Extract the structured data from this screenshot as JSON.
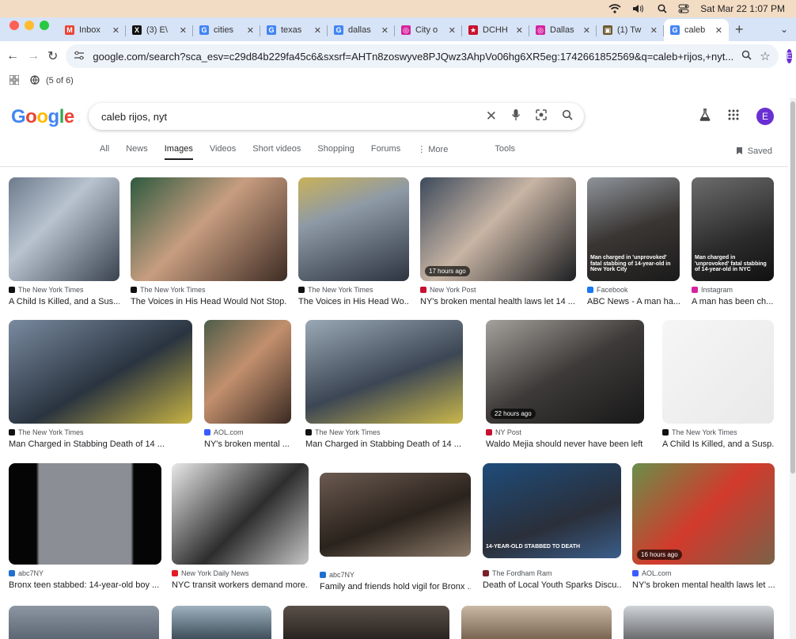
{
  "menubar": {
    "datetime": "Sat Mar 22  1:07 PM"
  },
  "tabs": [
    {
      "label": "Inbox",
      "fav": "M",
      "color": "#ea4335"
    },
    {
      "label": "(3) E\\",
      "fav": "X",
      "color": "#111111"
    },
    {
      "label": "cities",
      "fav": "G",
      "color": "#4285f4"
    },
    {
      "label": "texas",
      "fav": "G",
      "color": "#4285f4"
    },
    {
      "label": "dallas",
      "fav": "G",
      "color": "#4285f4"
    },
    {
      "label": "City o",
      "fav": "◎",
      "color": "#d6249f"
    },
    {
      "label": "DCHH",
      "fav": "★",
      "color": "#c8102e"
    },
    {
      "label": "Dallas",
      "fav": "◎",
      "color": "#d6249f"
    },
    {
      "label": "(1) Tw",
      "fav": "▣",
      "color": "#6b5a2e"
    },
    {
      "label": "caleb",
      "fav": "G",
      "color": "#4285f4"
    }
  ],
  "omnibox": {
    "url": "google.com/search?sca_esv=c29d84b229fa45c6&sxsrf=AHTn8zoswyve8PJQwz3AhpVo06hg6XR5eg:1742661852569&q=caleb+rijos,+nyt..."
  },
  "profile_initial": "E",
  "bookmarks": {
    "count": "(5 of 6)"
  },
  "search": {
    "query": "caleb rijos, nyt"
  },
  "logo": [
    "G",
    "o",
    "o",
    "g",
    "l",
    "e"
  ],
  "filters": [
    "All",
    "News",
    "Images",
    "Videos",
    "Short videos",
    "Shopping",
    "Forums",
    "⋮ More",
    "Tools"
  ],
  "saved_label": "Saved",
  "results": [
    {
      "source": "The New York Times",
      "title": "A Child Is Killed, and a Sus...",
      "badge": "",
      "overlay": ""
    },
    {
      "source": "The New York Times",
      "title": "The Voices in His Head Would Not Stop...",
      "badge": "",
      "overlay": ""
    },
    {
      "source": "The New York Times",
      "title": "The Voices in His Head Wo...",
      "badge": "",
      "overlay": ""
    },
    {
      "source": "New York Post",
      "title": "NY's broken mental health laws let 14 ...",
      "badge": "17 hours ago",
      "overlay": ""
    },
    {
      "source": "Facebook",
      "title": "ABC News - A man ha...",
      "badge": "",
      "overlay": "Man charged in 'unprovoked' fatal stabbing of 14-year-old in New York City"
    },
    {
      "source": "Instagram",
      "title": "A man has been ch...",
      "badge": "",
      "overlay": "Man charged in 'unprovoked' fatal stabbing of 14-year-old in NYC"
    },
    {
      "source": "The New York Times",
      "title": "Man Charged in Stabbing Death of 14 ...",
      "badge": "",
      "overlay": ""
    },
    {
      "source": "AOL.com",
      "title": "NY's broken mental ...",
      "badge": "",
      "overlay": ""
    },
    {
      "source": "The New York Times",
      "title": "Man Charged in Stabbing Death of 14 ...",
      "badge": "",
      "overlay": ""
    },
    {
      "source": "NY Post",
      "title": "Waldo Mejia should never have been left ...",
      "badge": "22 hours ago",
      "overlay": ""
    },
    {
      "source": "The New York Times",
      "title": "A Child Is Killed, and a Susp...",
      "badge": "",
      "overlay": ""
    },
    {
      "source": "abc7NY",
      "title": "Bronx teen stabbed: 14-year-old boy ...",
      "badge": "",
      "overlay": ""
    },
    {
      "source": "New York Daily News",
      "title": "NYC transit workers demand more...",
      "badge": "",
      "overlay": ""
    },
    {
      "source": "abc7NY",
      "title": "Family and friends hold vigil for Bronx ...",
      "badge": "",
      "overlay": ""
    },
    {
      "source": "The Fordham Ram",
      "title": "Death of Local Youth Sparks Discu...",
      "badge": "",
      "overlay": "14-YEAR-OLD STABBED TO DEATH"
    },
    {
      "source": "AOL.com",
      "title": "NY's broken mental health laws let ...",
      "badge": "16 hours ago",
      "overlay": ""
    }
  ]
}
